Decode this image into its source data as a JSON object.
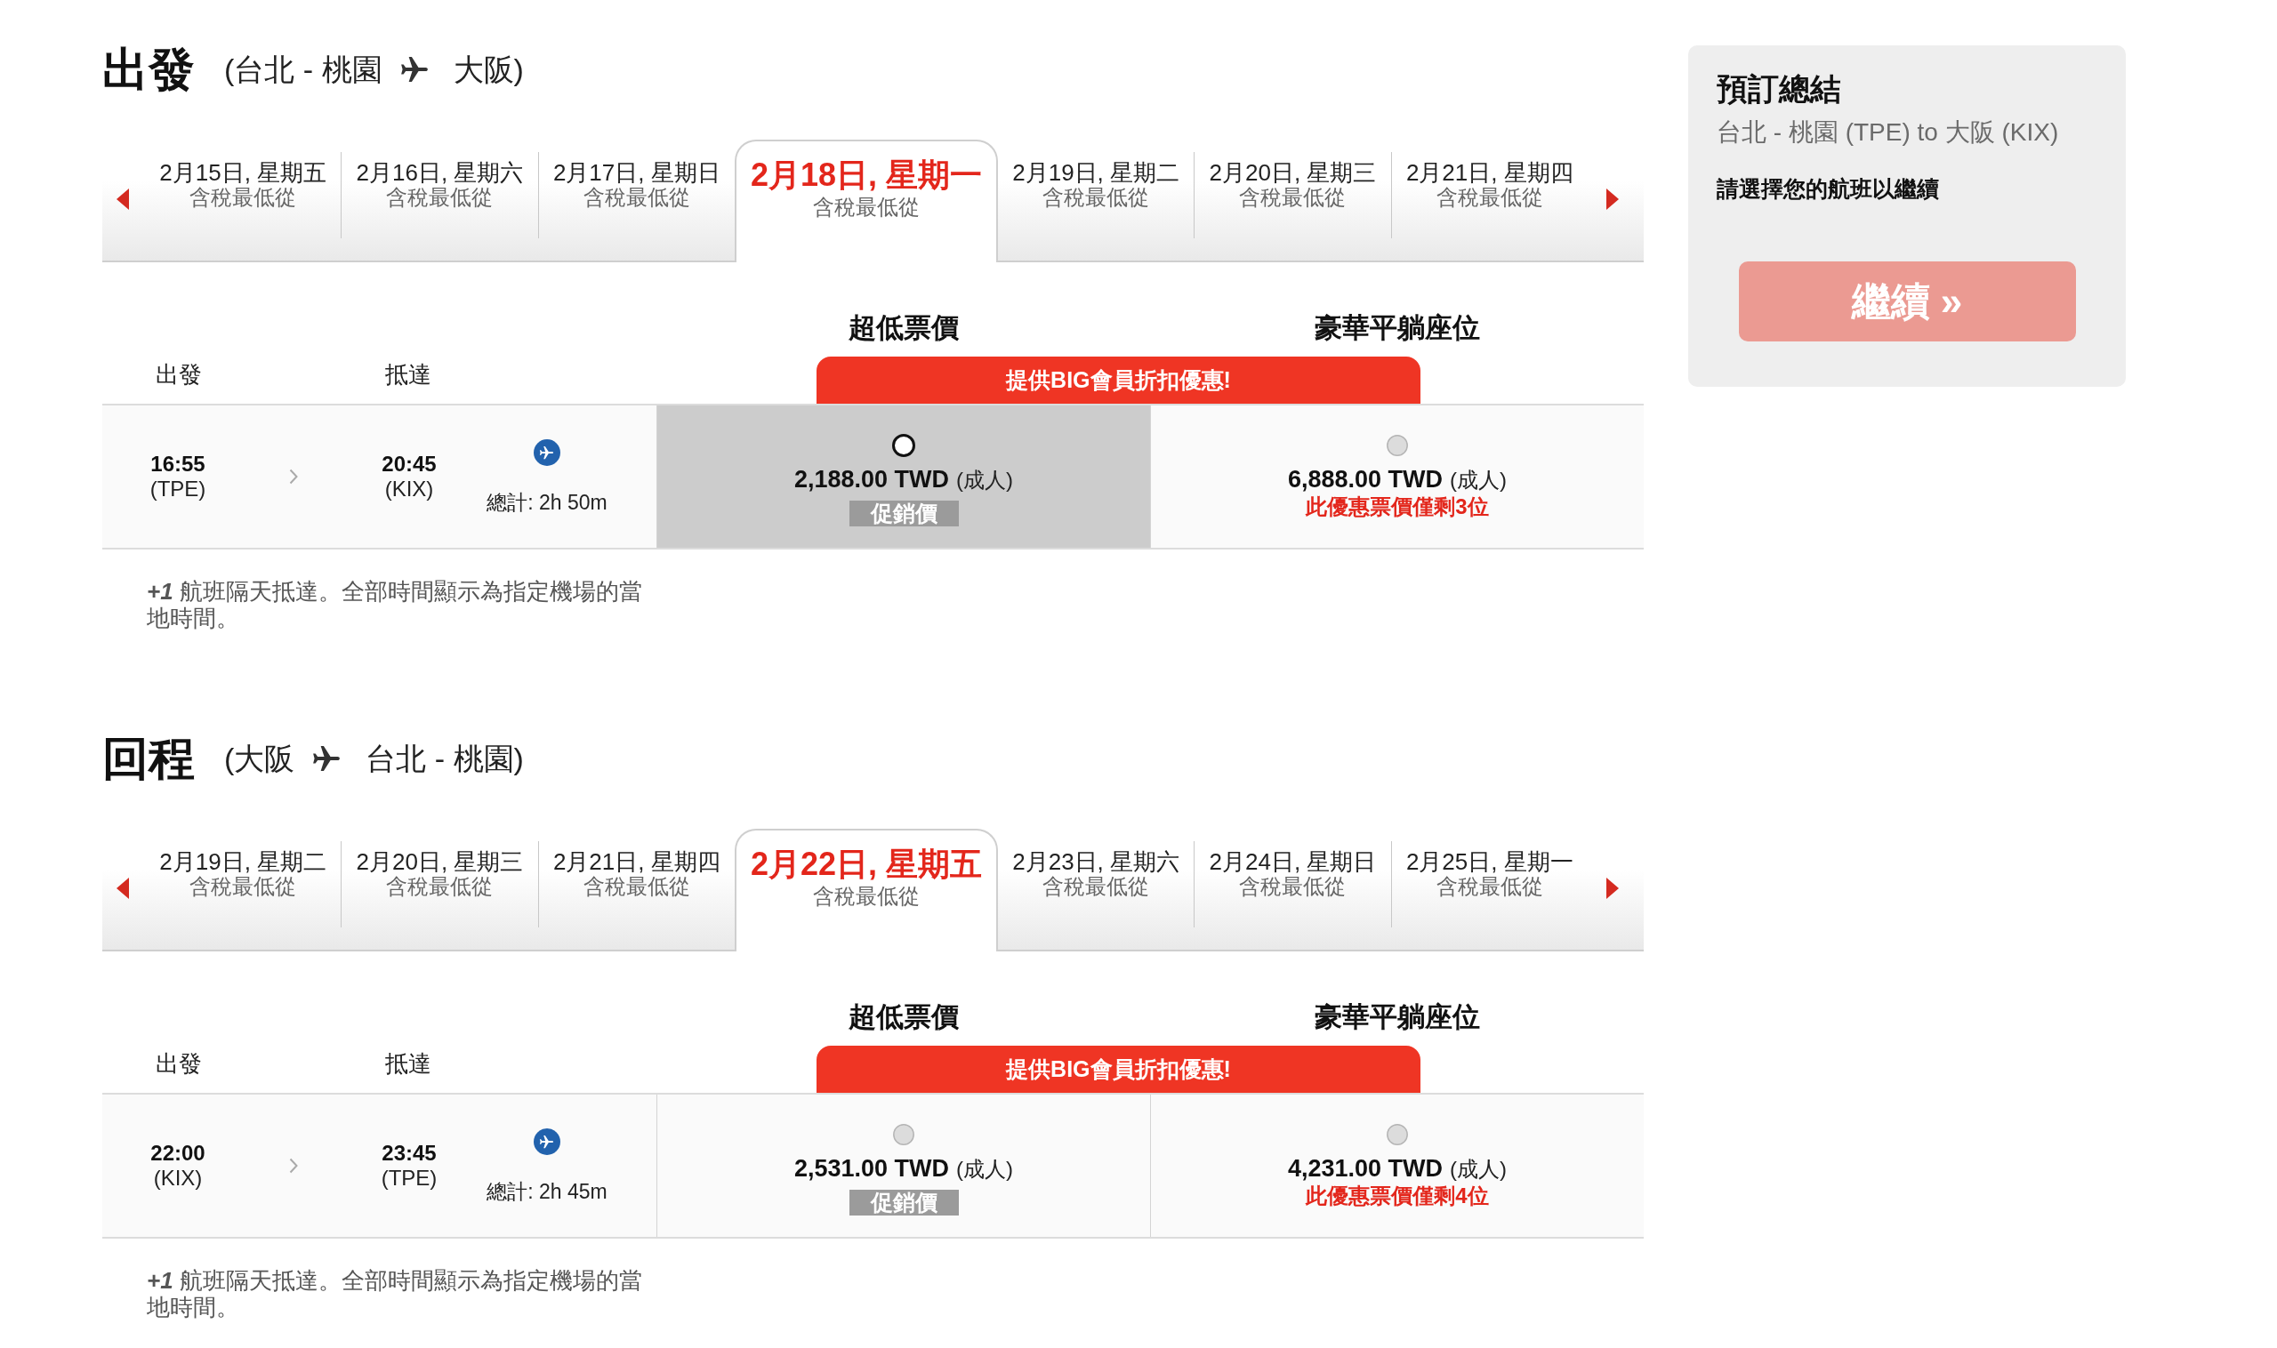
{
  "journeys": [
    {
      "title": "出發",
      "route": {
        "from": "(台北 - 桃園",
        "to": "大阪)"
      },
      "dates": [
        {
          "date": "2月15日, 星期五",
          "note": "含稅最低從",
          "selected": false
        },
        {
          "date": "2月16日, 星期六",
          "note": "含稅最低從",
          "selected": false
        },
        {
          "date": "2月17日, 星期日",
          "note": "含稅最低從",
          "selected": false
        },
        {
          "date": "2月18日, 星期一",
          "note": "含稅最低從",
          "selected": true
        },
        {
          "date": "2月19日, 星期二",
          "note": "含稅最低從",
          "selected": false
        },
        {
          "date": "2月20日, 星期三",
          "note": "含稅最低從",
          "selected": false
        },
        {
          "date": "2月21日, 星期四",
          "note": "含稅最低從",
          "selected": false
        }
      ],
      "fare_types": [
        "超低票價",
        "豪華平躺座位"
      ],
      "columns": [
        "出發",
        "抵達"
      ],
      "promo_banner": "提供BIG會員折扣優惠!",
      "flights": [
        {
          "depart_time": "16:55",
          "depart_airport": "(TPE)",
          "arrive_time": "20:45",
          "arrive_airport": "(KIX)",
          "duration": "總計: 2h 50m",
          "fares": [
            {
              "price": "2,188.00 TWD",
              "passenger": "(成人)",
              "selected": true,
              "badge": "促銷價"
            },
            {
              "price": "6,888.00 TWD",
              "passenger": "(成人)",
              "selected": false,
              "seats_left": "此優惠票價僅剩3位"
            }
          ]
        }
      ],
      "footnote": "*+1* 航班隔天抵達。全部時間顯示為指定機場的當地時間。"
    },
    {
      "title": "回程",
      "route": {
        "from": "(大阪",
        "to": "台北 - 桃園)"
      },
      "dates": [
        {
          "date": "2月19日, 星期二",
          "note": "含稅最低從",
          "selected": false
        },
        {
          "date": "2月20日, 星期三",
          "note": "含稅最低從",
          "selected": false
        },
        {
          "date": "2月21日, 星期四",
          "note": "含稅最低從",
          "selected": false
        },
        {
          "date": "2月22日, 星期五",
          "note": "含稅最低從",
          "selected": true
        },
        {
          "date": "2月23日, 星期六",
          "note": "含稅最低從",
          "selected": false
        },
        {
          "date": "2月24日, 星期日",
          "note": "含稅最低從",
          "selected": false
        },
        {
          "date": "2月25日, 星期一",
          "note": "含稅最低從",
          "selected": false
        }
      ],
      "fare_types": [
        "超低票價",
        "豪華平躺座位"
      ],
      "columns": [
        "出發",
        "抵達"
      ],
      "promo_banner": "提供BIG會員折扣優惠!",
      "flights": [
        {
          "depart_time": "22:00",
          "depart_airport": "(KIX)",
          "arrive_time": "23:45",
          "arrive_airport": "(TPE)",
          "duration": "總計: 2h 45m",
          "fares": [
            {
              "price": "2,531.00 TWD",
              "passenger": "(成人)",
              "selected": false,
              "badge": "促銷價"
            },
            {
              "price": "4,231.00 TWD",
              "passenger": "(成人)",
              "selected": false,
              "seats_left": "此優惠票價僅剩4位"
            }
          ]
        }
      ],
      "footnote": "*+1* 航班隔天抵達。全部時間顯示為指定機場的當地時間。"
    }
  ],
  "summary": {
    "title": "預訂總結",
    "route": "台北 - 桃園 (TPE) to 大阪 (KIX)",
    "prompt": "請選擇您的航班以繼續",
    "button": {
      "label": "繼續 »",
      "disabled": true
    }
  }
}
